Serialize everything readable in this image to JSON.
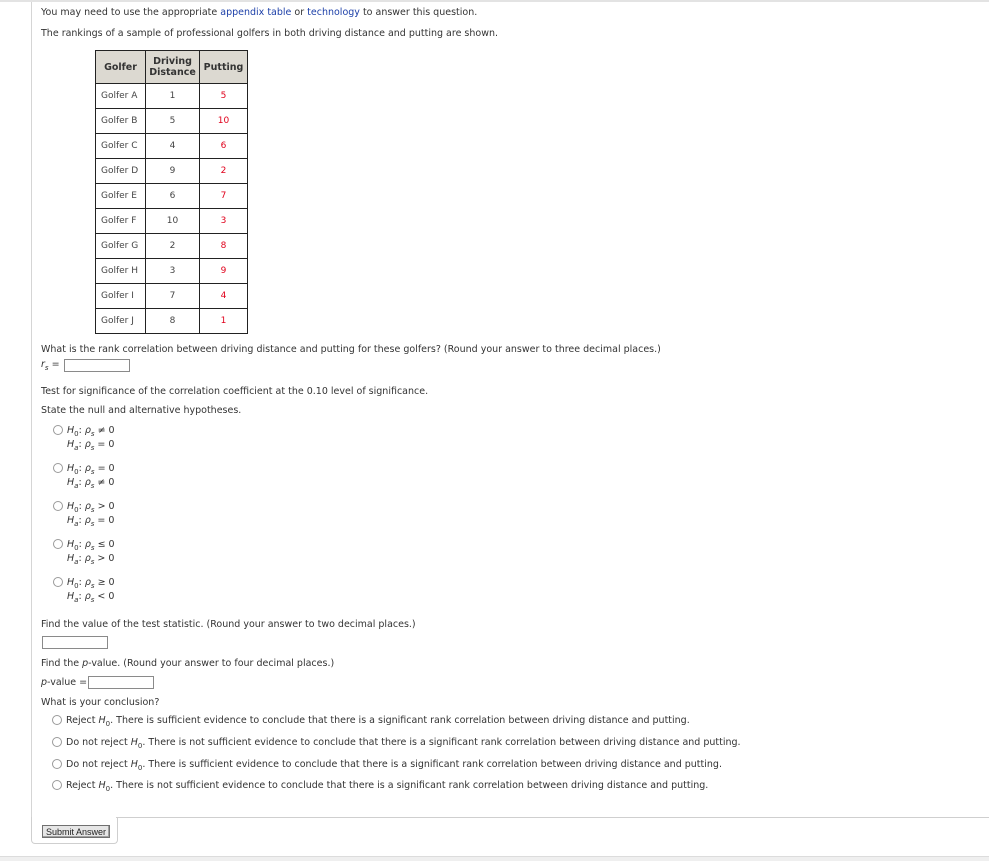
{
  "intro": {
    "line1_before": "You may need to use the appropriate ",
    "link1": "appendix table",
    "line1_mid": " or ",
    "link2": "technology",
    "line1_after": " to answer this question.",
    "line2": "The rankings of a sample of professional golfers in both driving distance and putting are shown."
  },
  "table": {
    "headers": [
      "Golfer",
      "Driving",
      "Distance",
      "Putting"
    ],
    "rows": [
      {
        "golfer": "Golfer A",
        "driving": "1",
        "putting": "5"
      },
      {
        "golfer": "Golfer B",
        "driving": "5",
        "putting": "10"
      },
      {
        "golfer": "Golfer C",
        "driving": "4",
        "putting": "6"
      },
      {
        "golfer": "Golfer D",
        "driving": "9",
        "putting": "2"
      },
      {
        "golfer": "Golfer E",
        "driving": "6",
        "putting": "7"
      },
      {
        "golfer": "Golfer F",
        "driving": "10",
        "putting": "3"
      },
      {
        "golfer": "Golfer G",
        "driving": "2",
        "putting": "8"
      },
      {
        "golfer": "Golfer H",
        "driving": "3",
        "putting": "9"
      },
      {
        "golfer": "Golfer I",
        "driving": "7",
        "putting": "4"
      },
      {
        "golfer": "Golfer J",
        "driving": "8",
        "putting": "1"
      }
    ],
    "putting_color": "#e0001b"
  },
  "q1": {
    "text": "What is the rank correlation between driving distance and putting for these golfers? (Round your answer to three decimal places.)",
    "label_var": "r",
    "label_sub": "s",
    "label_eq": " =",
    "value": ""
  },
  "q2": {
    "text1": "Test for significance of the correlation coefficient at the 0.10 level of significance.",
    "text2": "State the null and alternative hypotheses.",
    "options": [
      {
        "h0_op": "≠ 0",
        "ha_op": "= 0"
      },
      {
        "h0_op": "= 0",
        "ha_op": "≠ 0"
      },
      {
        "h0_op": "> 0",
        "ha_op": "= 0"
      },
      {
        "h0_op": "≤ 0",
        "ha_op": "> 0"
      },
      {
        "h0_op": "≥ 0",
        "ha_op": "< 0"
      }
    ],
    "H": "H",
    "sub0": "0",
    "suba": "a",
    "rho": "ρ",
    "rho_sub": "s"
  },
  "q3": {
    "text": "Find the value of the test statistic. (Round your answer to two decimal places.)",
    "value": ""
  },
  "q4": {
    "text_before": "Find the ",
    "text_p": "p",
    "text_after": "-value. (Round your answer to four decimal places.)",
    "label_p": "p",
    "label_rest": "-value =",
    "value": ""
  },
  "q5": {
    "text": "What is your conclusion?",
    "options": [
      {
        "action": "Reject ",
        "rest": ". There is sufficient evidence to conclude that there is a significant rank correlation between driving distance and putting."
      },
      {
        "action": "Do not reject ",
        "rest": ". There is not sufficient evidence to conclude that there is a significant rank correlation between driving distance and putting."
      },
      {
        "action": "Do not reject ",
        "rest": ". There is sufficient evidence to conclude that there is a significant rank correlation between driving distance and putting."
      },
      {
        "action": "Reject ",
        "rest": ". There is not sufficient evidence to conclude that there is a significant rank correlation between driving distance and putting."
      }
    ]
  },
  "submit": {
    "label": "Submit Answer"
  },
  "colors": {
    "link": "#1c3fa8",
    "table_header_bg": "#dcd9d1"
  }
}
